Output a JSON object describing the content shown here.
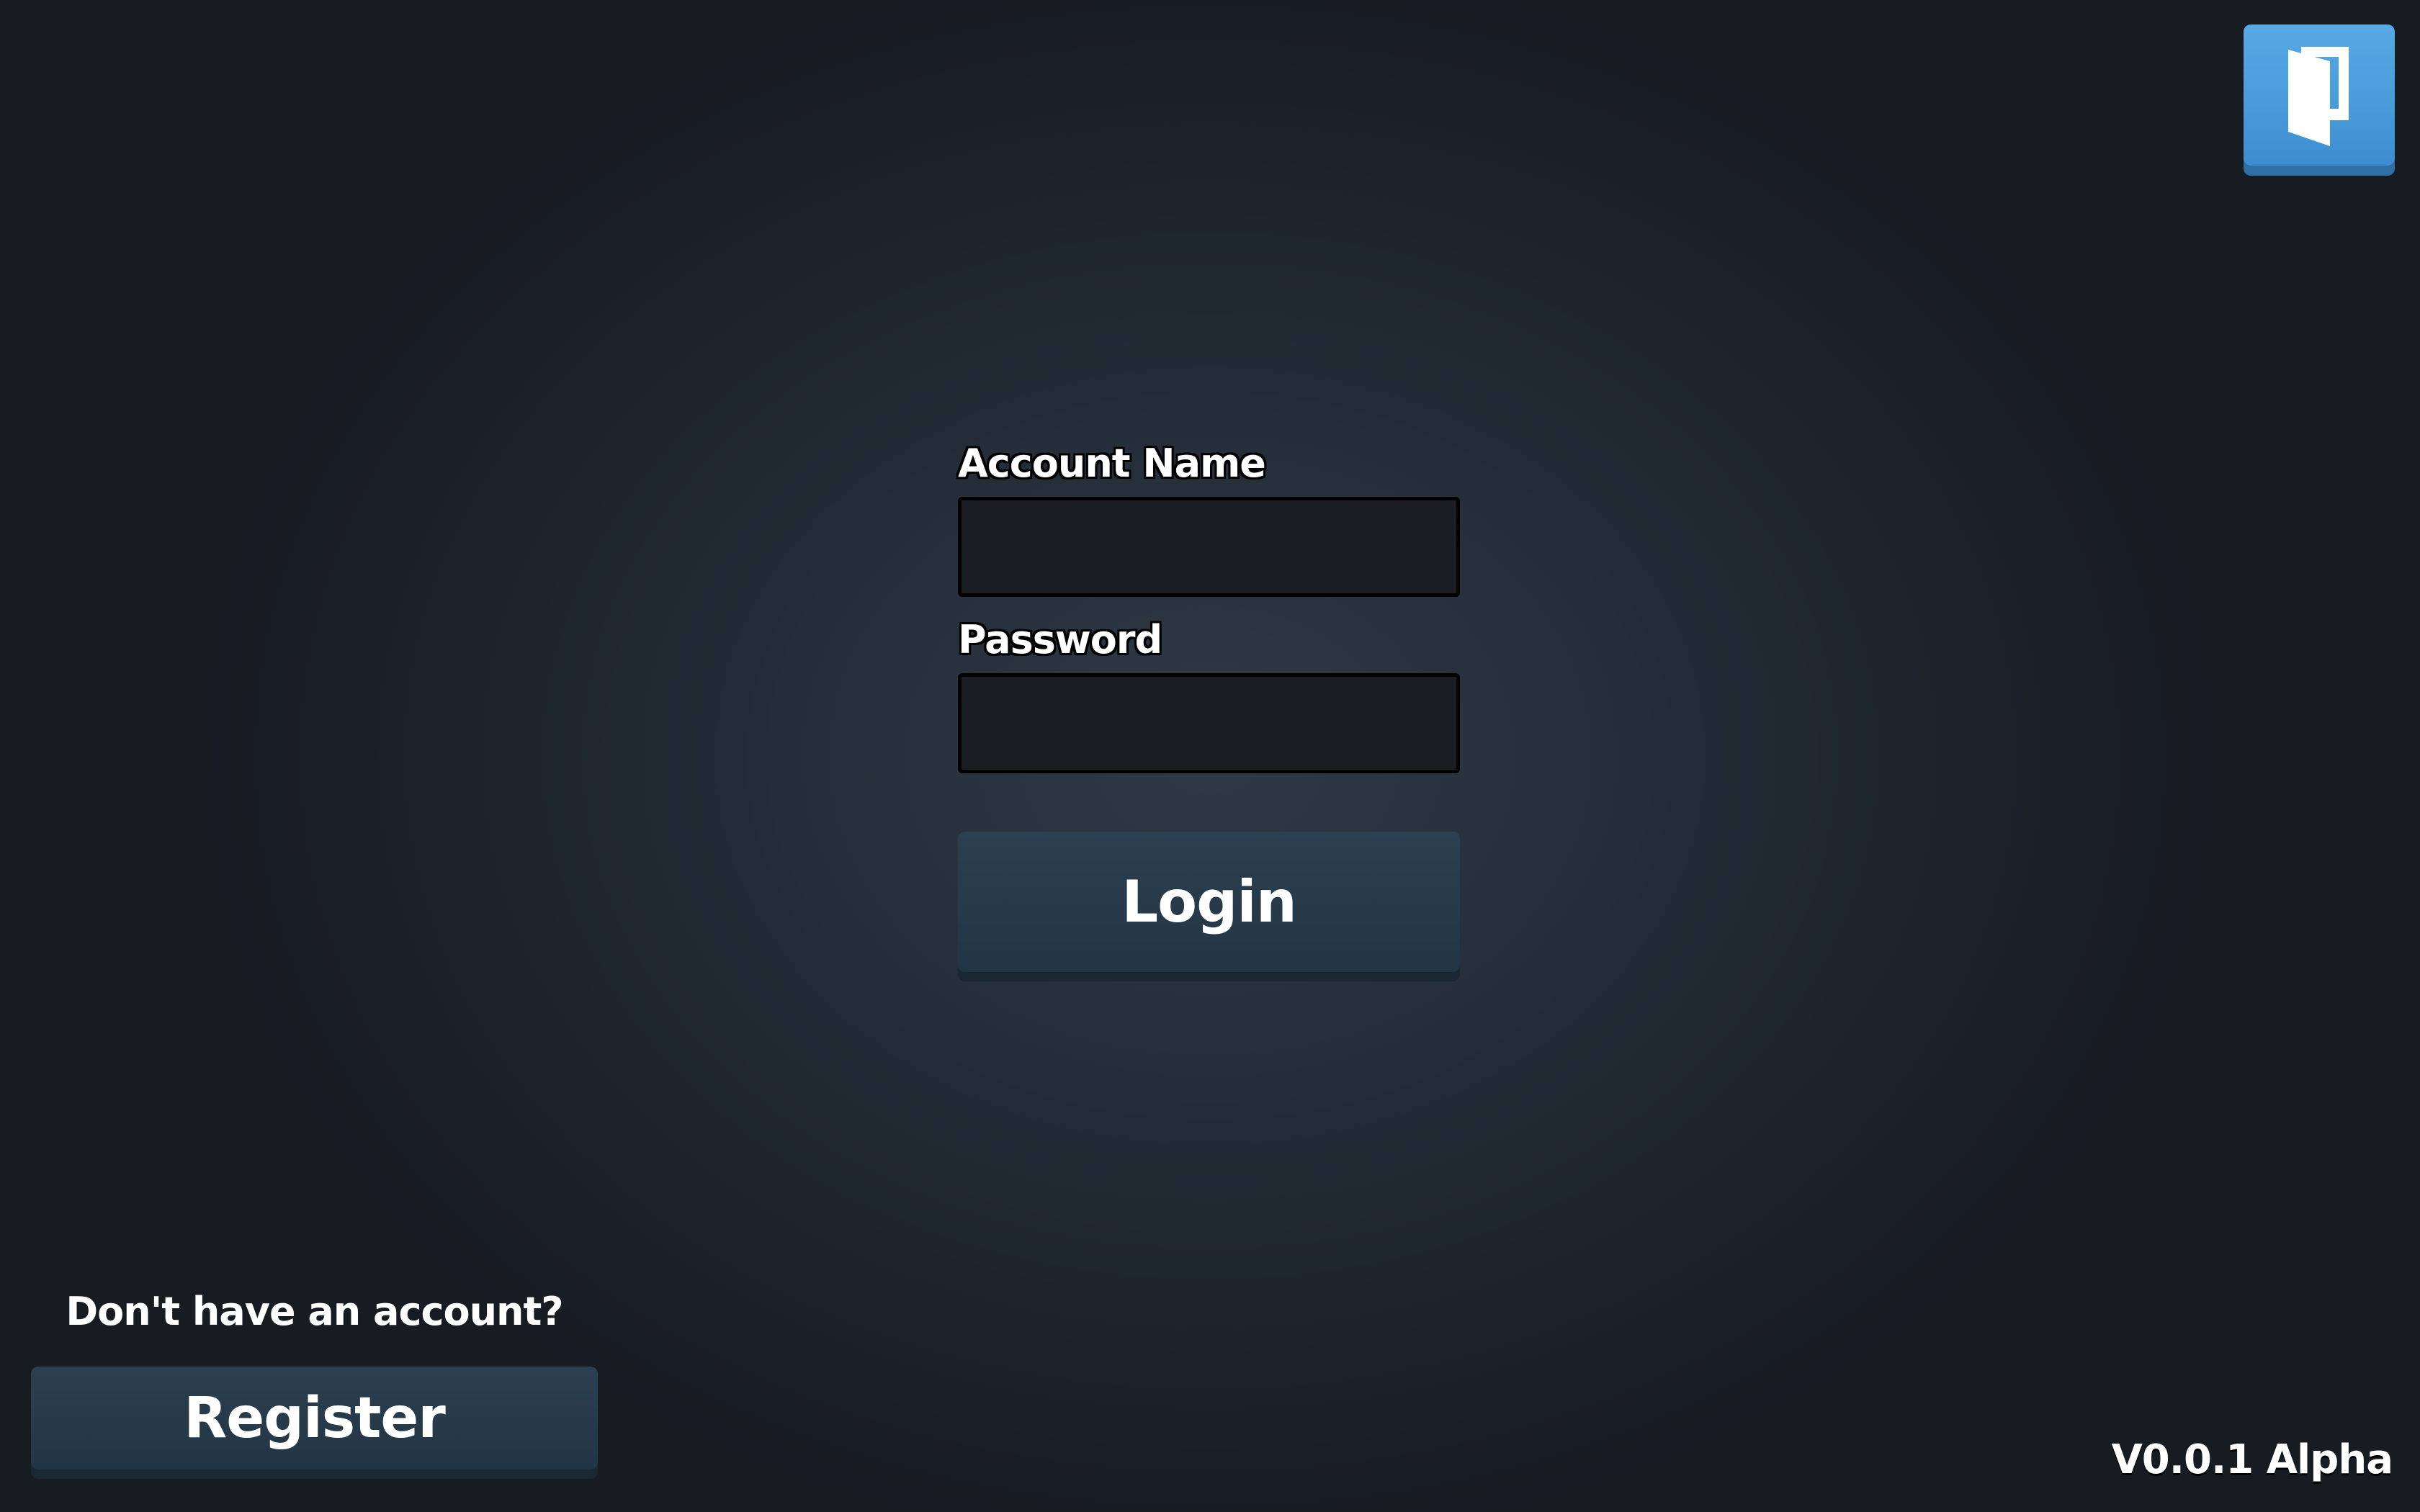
{
  "login_form": {
    "account_name_label": "Account Name",
    "account_name_value": "",
    "password_label": "Password",
    "password_value": "",
    "login_button": "Login"
  },
  "register": {
    "prompt": "Don't have an account?",
    "button": "Register"
  },
  "corner_button": {
    "icon": "door-exit-icon"
  },
  "version": "V0.0.1 Alpha",
  "colors": {
    "background": "#26303b",
    "field_background": "#1a1d21",
    "primary_button": "#2b4050",
    "accent_button": "#4a9ddc"
  }
}
